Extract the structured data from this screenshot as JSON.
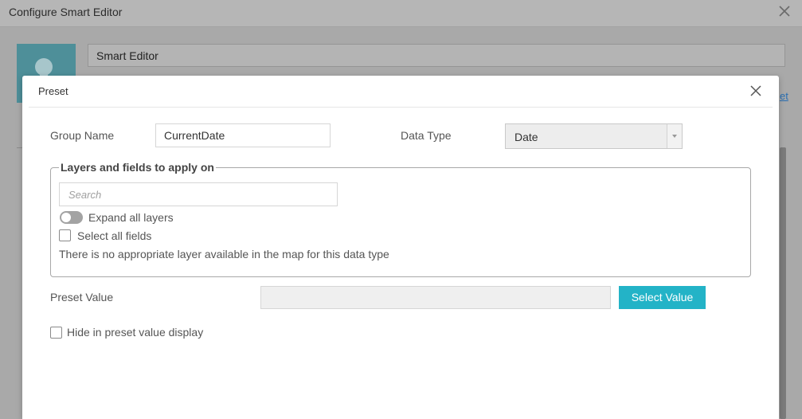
{
  "background": {
    "title": "Configure Smart Editor",
    "widget_name": "Smart Editor",
    "link_fragment": "et"
  },
  "modal": {
    "title": "Preset",
    "group_name_label": "Group Name",
    "group_name_value": "CurrentDate",
    "data_type_label": "Data Type",
    "data_type_value": "Date",
    "fieldset_legend": "Layers and fields to apply on",
    "search_placeholder": "Search",
    "expand_all_label": "Expand all layers",
    "select_all_label": "Select all fields",
    "no_layer_message": "There is no appropriate layer available in the map for this data type",
    "preset_value_label": "Preset Value",
    "preset_value": "",
    "select_value_button": "Select Value",
    "hide_label": "Hide in preset value display"
  },
  "colors": {
    "accent": "#23b3c7",
    "overlay": "#a9a9a9",
    "toggle_off": "#a3a3a3"
  },
  "icons": {
    "close": "close-icon",
    "dropdown": "chevron-down-icon",
    "widget": "lightbulb-icon"
  }
}
